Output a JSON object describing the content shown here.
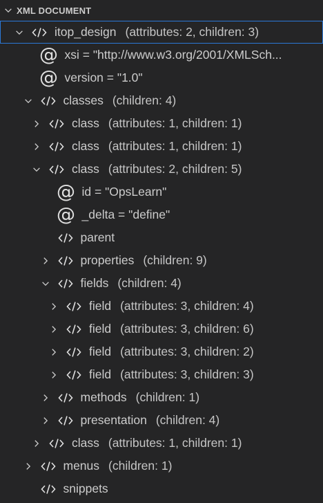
{
  "panel": {
    "title": "XML DOCUMENT"
  },
  "rows": [
    {
      "depth": 0,
      "twisty": "expanded",
      "icon": "element",
      "label": "itop_design",
      "desc": "(attributes: 2, children: 3)"
    },
    {
      "depth": 1,
      "twisty": "none",
      "icon": "attribute",
      "label": "xsi = \"http://www.w3.org/2001/XMLSch...",
      "desc": ""
    },
    {
      "depth": 1,
      "twisty": "none",
      "icon": "attribute",
      "label": "version = \"1.0\"",
      "desc": ""
    },
    {
      "depth": 1,
      "twisty": "expanded",
      "icon": "element",
      "label": "classes",
      "desc": "(children: 4)"
    },
    {
      "depth": 2,
      "twisty": "collapsed",
      "icon": "element",
      "label": "class",
      "desc": "(attributes: 1, children: 1)"
    },
    {
      "depth": 2,
      "twisty": "collapsed",
      "icon": "element",
      "label": "class",
      "desc": "(attributes: 1, children: 1)"
    },
    {
      "depth": 2,
      "twisty": "expanded",
      "icon": "element",
      "label": "class",
      "desc": "(attributes: 2, children: 5)"
    },
    {
      "depth": 3,
      "twisty": "none",
      "icon": "attribute",
      "label": "id = \"OpsLearn\"",
      "desc": ""
    },
    {
      "depth": 3,
      "twisty": "none",
      "icon": "attribute",
      "label": "_delta = \"define\"",
      "desc": ""
    },
    {
      "depth": 3,
      "twisty": "none",
      "icon": "element",
      "label": "parent",
      "desc": ""
    },
    {
      "depth": 3,
      "twisty": "collapsed",
      "icon": "element",
      "label": "properties",
      "desc": "(children: 9)"
    },
    {
      "depth": 3,
      "twisty": "expanded",
      "icon": "element",
      "label": "fields",
      "desc": "(children: 4)"
    },
    {
      "depth": 4,
      "twisty": "collapsed",
      "icon": "element",
      "label": "field",
      "desc": "(attributes: 3, children: 4)"
    },
    {
      "depth": 4,
      "twisty": "collapsed",
      "icon": "element",
      "label": "field",
      "desc": "(attributes: 3, children: 6)"
    },
    {
      "depth": 4,
      "twisty": "collapsed",
      "icon": "element",
      "label": "field",
      "desc": "(attributes: 3, children: 2)"
    },
    {
      "depth": 4,
      "twisty": "collapsed",
      "icon": "element",
      "label": "field",
      "desc": "(attributes: 3, children: 3)"
    },
    {
      "depth": 3,
      "twisty": "collapsed",
      "icon": "element",
      "label": "methods",
      "desc": "(children: 1)"
    },
    {
      "depth": 3,
      "twisty": "collapsed",
      "icon": "element",
      "label": "presentation",
      "desc": "(children: 4)"
    },
    {
      "depth": 2,
      "twisty": "collapsed",
      "icon": "element",
      "label": "class",
      "desc": "(attributes: 1, children: 1)"
    },
    {
      "depth": 1,
      "twisty": "collapsed",
      "icon": "element",
      "label": "menus",
      "desc": "(children: 1)"
    },
    {
      "depth": 1,
      "twisty": "none",
      "icon": "element",
      "label": "snippets",
      "desc": ""
    }
  ],
  "icons": {
    "panel_chevron": "chevron-down-icon",
    "element": "code-tag-icon",
    "attribute": "at-sign-icon",
    "expanded": "chevron-down-icon",
    "collapsed": "chevron-right-icon"
  },
  "colors": {
    "background": "#252526",
    "text": "#cccccc",
    "selection_outline": "#2b79d8"
  }
}
